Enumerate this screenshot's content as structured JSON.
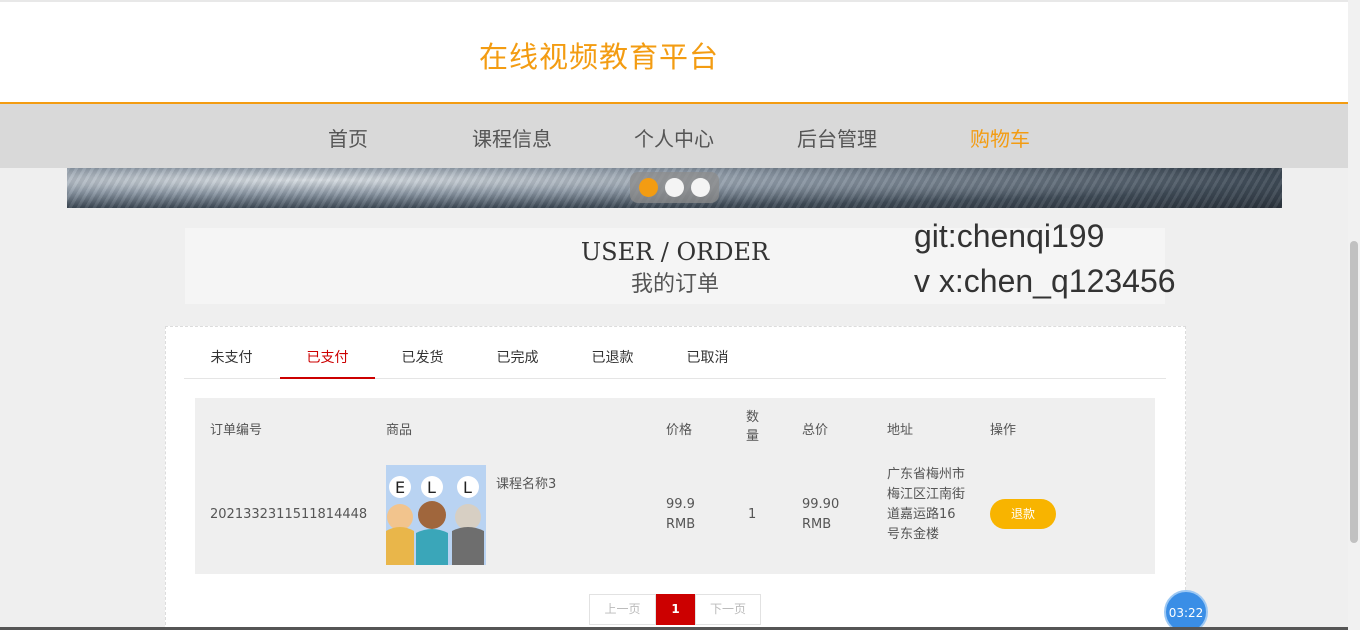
{
  "site": {
    "title": "在线视频教育平台"
  },
  "nav": {
    "items": [
      "首页",
      "课程信息",
      "个人中心",
      "后台管理",
      "购物车"
    ],
    "active_index": 4
  },
  "carousel": {
    "dot_count": 3,
    "active_dot": 0
  },
  "order_header": {
    "title_en": "USER / ORDER",
    "title_cn": "我的订单"
  },
  "watermark": {
    "line1": "git:chenqi199",
    "line2": "v x:chen_q123456"
  },
  "tabs": {
    "items": [
      "未支付",
      "已支付",
      "已发货",
      "已完成",
      "已退款",
      "已取消"
    ],
    "active_index": 1
  },
  "table": {
    "headers": [
      "订单编号",
      "商品",
      "价格",
      "数量",
      "总价",
      "地址",
      "操作"
    ],
    "rows": [
      {
        "order_no": "2021332311511814448",
        "product_name": "课程名称3",
        "price": "99.9 RMB",
        "quantity": "1",
        "total": "99.90 RMB",
        "address": "广东省梅州市梅江区江南街道嘉运路16号东金楼",
        "action_label": "退款"
      }
    ]
  },
  "pagination": {
    "prev_label": "上一页",
    "current": "1",
    "next_label": "下一页"
  },
  "timer": {
    "label": "03:22"
  },
  "colors": {
    "accent": "#f39c12",
    "active_tab": "#cc0000",
    "button": "#f8b400"
  }
}
